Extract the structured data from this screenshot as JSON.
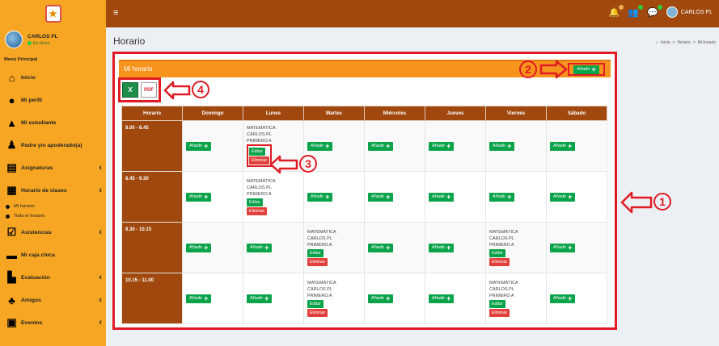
{
  "topbar": {
    "menu_toggle": "≡",
    "user_name": "CARLOS PL"
  },
  "sidebar": {
    "user": {
      "name": "CARLOS PL",
      "status": "En línea"
    },
    "header": "Menú Principal",
    "items": [
      {
        "label": "Inicio",
        "icon": "home-icon"
      },
      {
        "label": "Mi perfil",
        "icon": "user-icon"
      },
      {
        "label": "Mi estudiante",
        "icon": "graduation-cap-icon"
      },
      {
        "label": "Padre y/o apoderado(a)",
        "icon": "users-icon"
      },
      {
        "label": "Asignaturas",
        "icon": "book-icon"
      },
      {
        "label": "Horario de clases",
        "icon": "calendar-icon"
      },
      {
        "label": "Asistencias",
        "icon": "calendar-check-icon"
      },
      {
        "label": "Mi caja chica",
        "icon": "money-icon"
      },
      {
        "label": "Evaluación",
        "icon": "evaluation-icon"
      },
      {
        "label": "Amigos",
        "icon": "friends-icon"
      },
      {
        "label": "Eventos",
        "icon": "gift-icon"
      }
    ],
    "subitems": [
      "Mi horario",
      "Todo el horario"
    ]
  },
  "page": {
    "title": "Horario",
    "breadcrumb": [
      "Inicio",
      "Horario",
      "Mi horario"
    ]
  },
  "panel": {
    "title": "Mi horario",
    "add_label": "Añadir",
    "export_excel": "X",
    "export_pdf": "PDF"
  },
  "table": {
    "headers": [
      "Horario",
      "Domingo",
      "Lunes",
      "Martes",
      "Miércoles",
      "Jueves",
      "Viernes",
      "Sábado"
    ],
    "rows": [
      {
        "time": "8.00 - 8.45"
      },
      {
        "time": "8.45 - 9.30"
      },
      {
        "time": "9.30 - 10.15"
      },
      {
        "time": "10.15 - 11.00"
      }
    ],
    "class_line1": "MATEMÁTICA",
    "class_line2": "CARLOS PL",
    "class_line3": "PRIMERO A",
    "edit_label": "Editar",
    "delete_label": "Eliminar",
    "add_label": "Añadir"
  },
  "callouts": [
    "1",
    "2",
    "3",
    "4"
  ],
  "colors": {
    "topbar": "#a0480d",
    "sidebar": "#f6a623",
    "panel_header": "#f7941d",
    "add_green": "#0aa34a",
    "delete_red": "#e2403a",
    "annotation_red": "#e01b24"
  }
}
